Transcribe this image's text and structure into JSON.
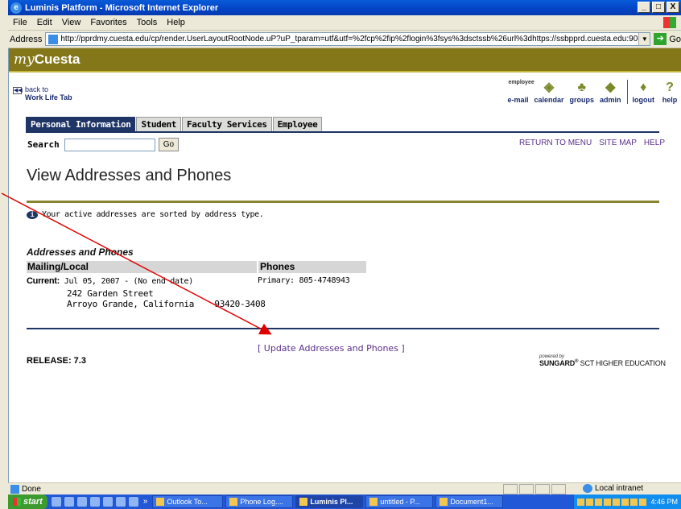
{
  "window": {
    "title": "Luminis Platform - Microsoft Internet Explorer",
    "buttons": [
      "_",
      "□",
      "X"
    ]
  },
  "menu": [
    "File",
    "Edit",
    "View",
    "Favorites",
    "Tools",
    "Help"
  ],
  "address": {
    "label": "Address",
    "url": "http://pprdmy.cuesta.edu/cp/render.UserLayoutRootNode.uP?uP_tparam=utf&utf=%2fcp%2fip%2flogin%3fsys%3dsctssb%26url%3dhttps://ssbpprd.cuesta.edu:9033/pprd/bwg",
    "go": "Go"
  },
  "brand": {
    "my": "my",
    "name": "Cuesta"
  },
  "back": {
    "line1": "back to",
    "line2": "Work Life Tab"
  },
  "header_icons": [
    {
      "label": "e-mail",
      "badge": "employee"
    },
    {
      "label": "calendar"
    },
    {
      "label": "groups"
    },
    {
      "label": "admin"
    },
    {
      "label": "logout"
    },
    {
      "label": "help"
    }
  ],
  "tabs": [
    "Personal Information",
    "Student",
    "Faculty Services",
    "Employee"
  ],
  "search": {
    "label": "Search",
    "value": "",
    "button": "Go"
  },
  "top_links": [
    "RETURN TO MENU",
    "SITE MAP",
    "HELP"
  ],
  "page_title": "View Addresses and Phones",
  "info": "Your active addresses are sorted by address type.",
  "section_heading": "Addresses and Phones",
  "table": {
    "col1": "Mailing/Local",
    "col2": "Phones",
    "current_label": "Current:",
    "current_dates": "Jul 05, 2007 - (No end date)",
    "street": "242 Garden Street",
    "city": "Arroyo Grande, California",
    "zip": "93420-3408",
    "phone": "Primary: 805-4748943"
  },
  "update_link": "[ Update Addresses and Phones ]",
  "release": "RELEASE: 7.3",
  "powered_by": {
    "line1": "powered by",
    "brand": "SUNGARD",
    "reg": "®",
    "rest": " SCT HIGHER EDUCATION"
  },
  "status": {
    "text": "Done",
    "zone": "Local intranet"
  },
  "taskbar": {
    "start": "start",
    "buttons": [
      "Outlook To...",
      "Phone Log....",
      "Luminis Pl...",
      "untitled - P...",
      "Document1..."
    ],
    "active_index": 2,
    "more": "»",
    "clock": "4:46 PM"
  },
  "colors": {
    "accent_navy": "#1e3565",
    "olive": "#84771a",
    "link_purple": "#5a2f8a",
    "arrow": "#e00000"
  }
}
